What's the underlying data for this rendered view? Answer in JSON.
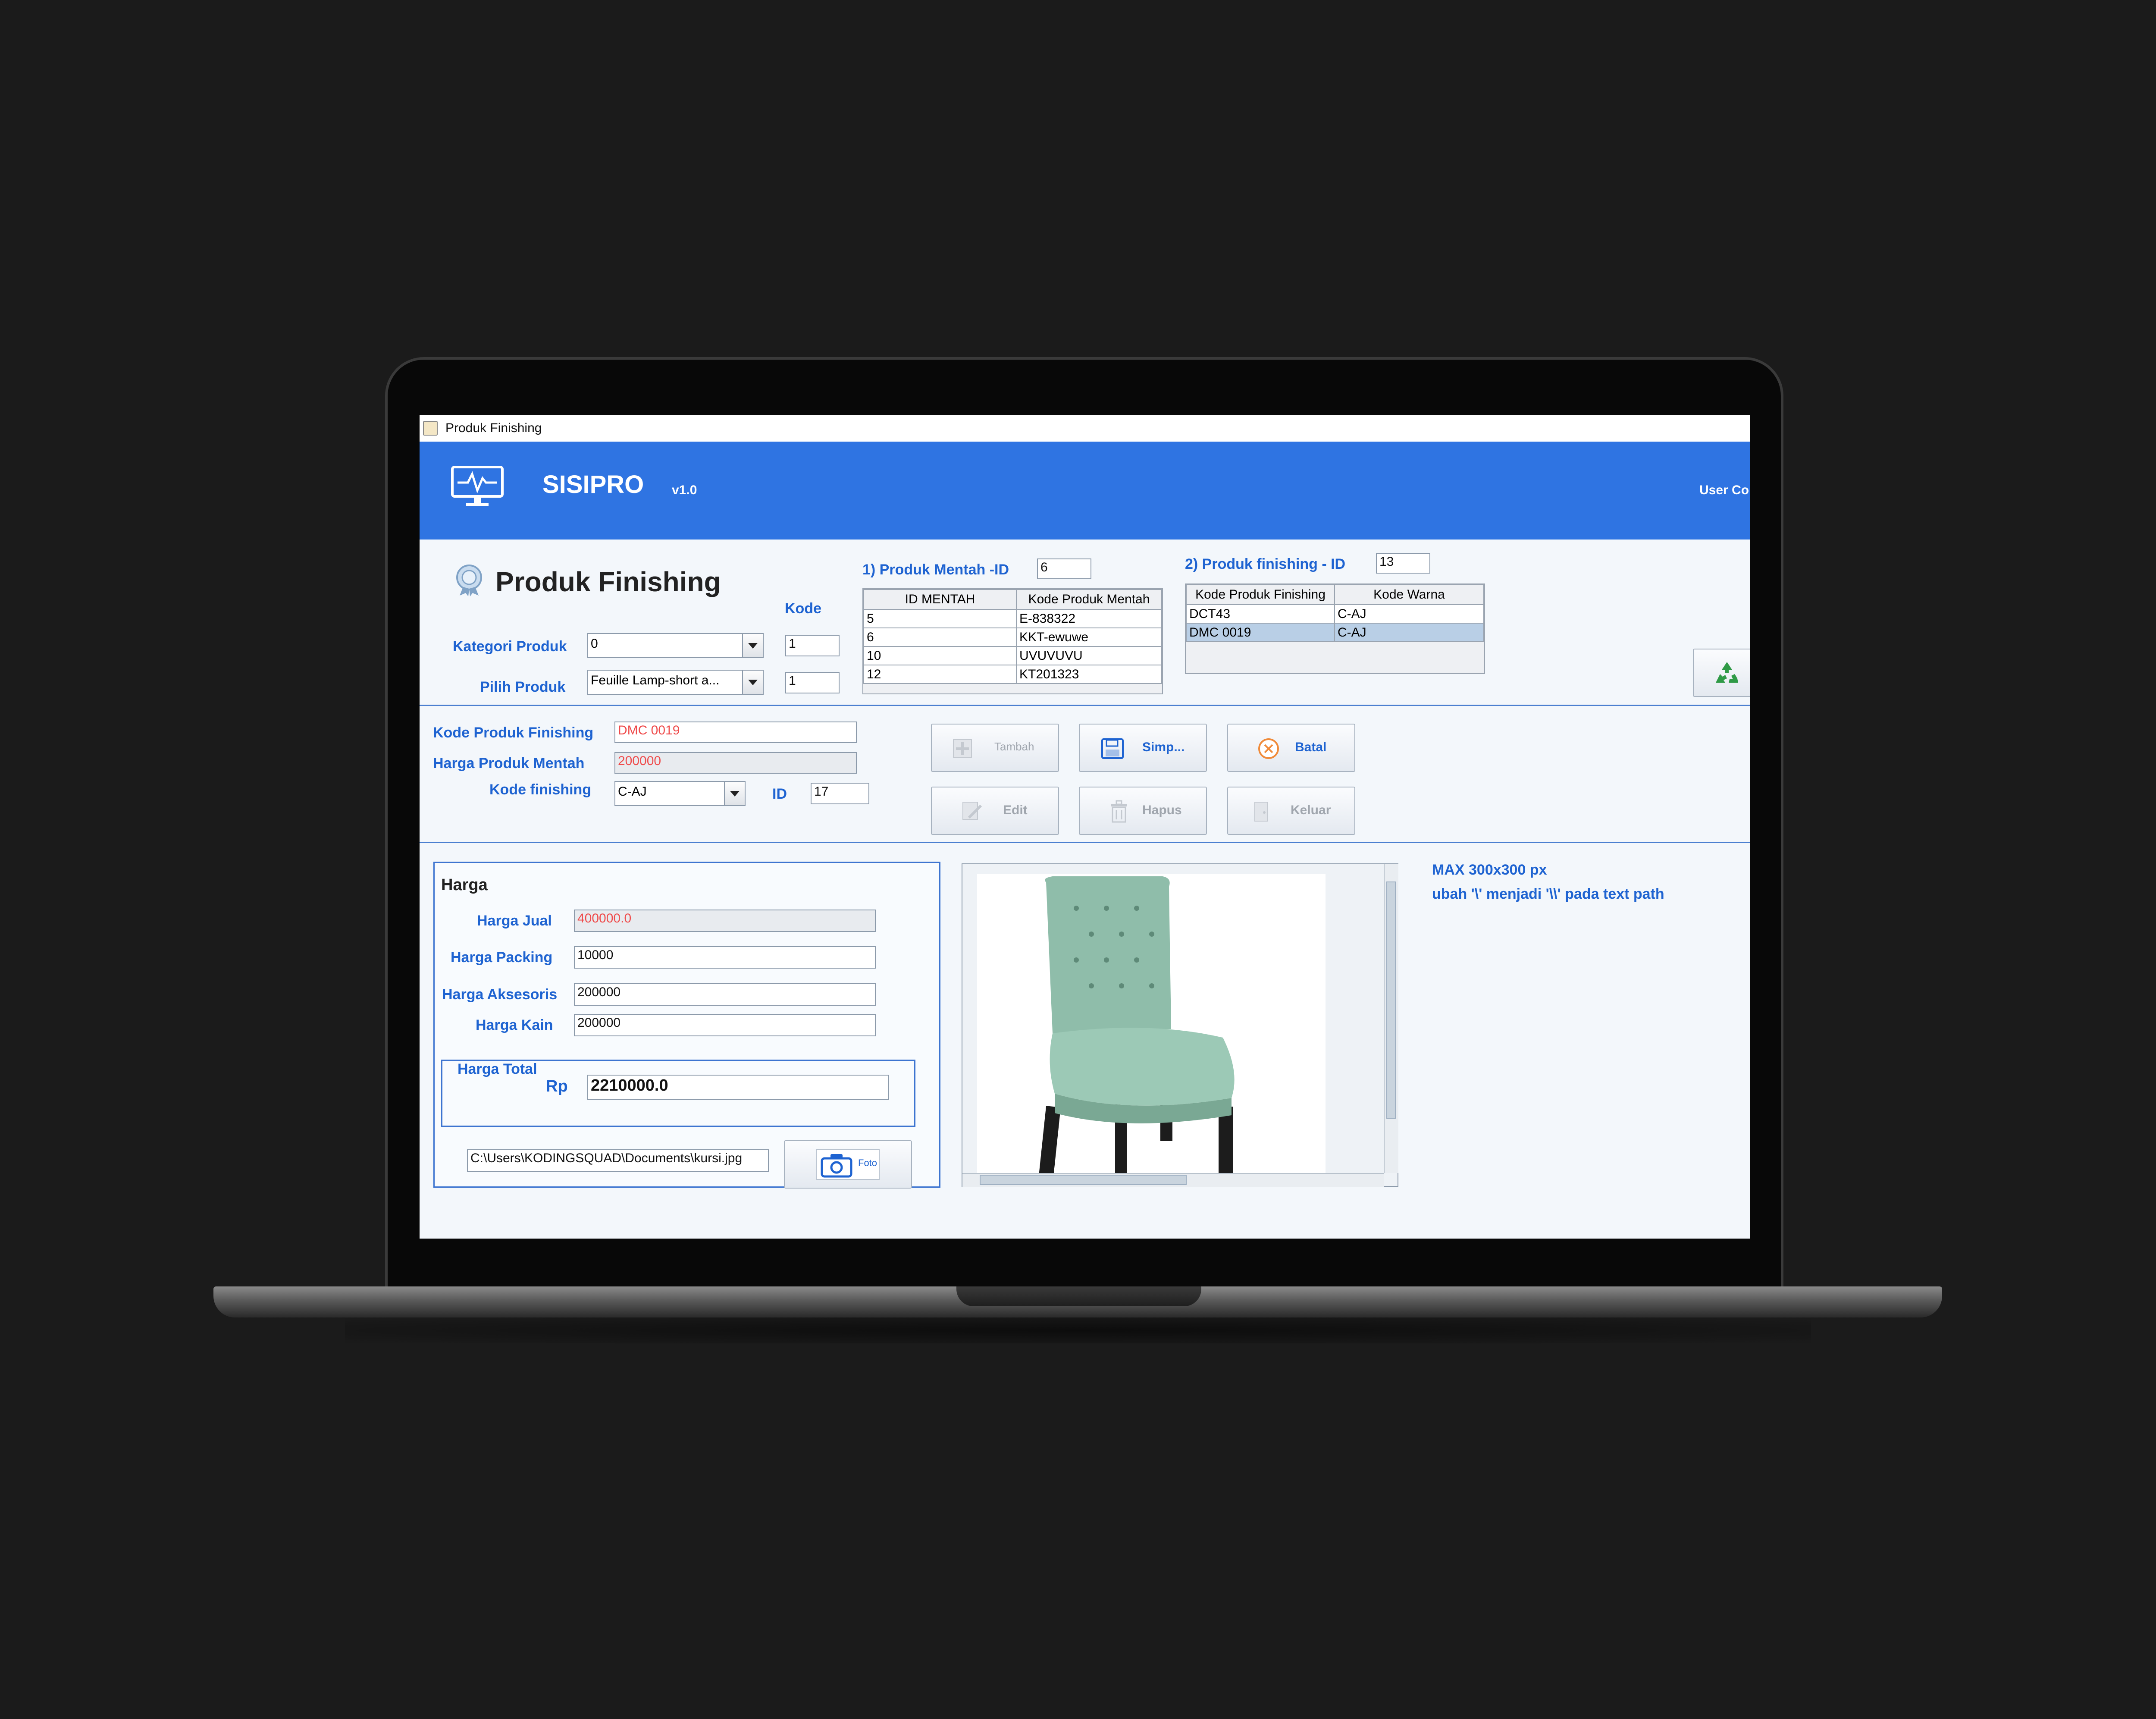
{
  "window": {
    "title": "Produk Finishing"
  },
  "header": {
    "app_name": "SISIPRO",
    "version": "v1.0",
    "user_label": "User Co"
  },
  "page": {
    "heading": "Produk Finishing"
  },
  "filters": {
    "kode_header": "Kode",
    "kategori_label": "Kategori Produk",
    "kategori_value": "0",
    "kategori_kode": "1",
    "pilih_label": "Pilih Produk",
    "pilih_value": "Feuille Lamp-short a...",
    "pilih_kode": "1"
  },
  "mentah": {
    "label": "1) Produk Mentah -ID",
    "id_value": "6",
    "columns": [
      "ID MENTAH",
      "Kode Produk Mentah"
    ],
    "rows": [
      [
        "5",
        "E-838322"
      ],
      [
        "6",
        "KKT-ewuwe"
      ],
      [
        "10",
        "UVUVUVU"
      ],
      [
        "12",
        "KT201323"
      ]
    ]
  },
  "finishing": {
    "label": "2) Produk finishing - ID",
    "id_value": "13",
    "columns": [
      "Kode Produk Finishing",
      "Kode Warna"
    ],
    "rows": [
      [
        "DCT43",
        "C-AJ"
      ],
      [
        "DMC 0019",
        "C-AJ"
      ]
    ],
    "selected_row": 1
  },
  "form": {
    "kode_produk_label": "Kode Produk Finishing",
    "kode_produk_value": "DMC 0019",
    "harga_mentah_label": "Harga Produk Mentah",
    "harga_mentah_value": "200000",
    "kode_finishing_label": "Kode finishing",
    "kode_finishing_value": "C-AJ",
    "id_label": "ID",
    "id_value": "17"
  },
  "actions": {
    "tambah": "Tambah",
    "simpan": "Simp...",
    "batal": "Batal",
    "edit": "Edit",
    "hapus": "Hapus",
    "keluar": "Keluar"
  },
  "harga": {
    "title": "Harga",
    "jual_label": "Harga Jual",
    "jual_value": "400000.0",
    "packing_label": "Harga Packing",
    "packing_value": "10000",
    "aksesoris_label": "Harga Aksesoris",
    "aksesoris_value": "200000",
    "kain_label": "Harga Kain",
    "kain_value": "200000",
    "total_title": "Harga Total",
    "currency": "Rp",
    "total_value": "2210000.0"
  },
  "photo": {
    "path": "C:\\Users\\KODINGSQUAD\\Documents\\kursi.jpg",
    "button": "Foto",
    "hint_size": "MAX 300x300 px",
    "hint_path": "ubah '\\' menjadi '\\\\' pada text path"
  },
  "colors": {
    "banner": "#2f74e2",
    "label_blue": "#1e63d1",
    "error_red": "#ef4b4b"
  }
}
